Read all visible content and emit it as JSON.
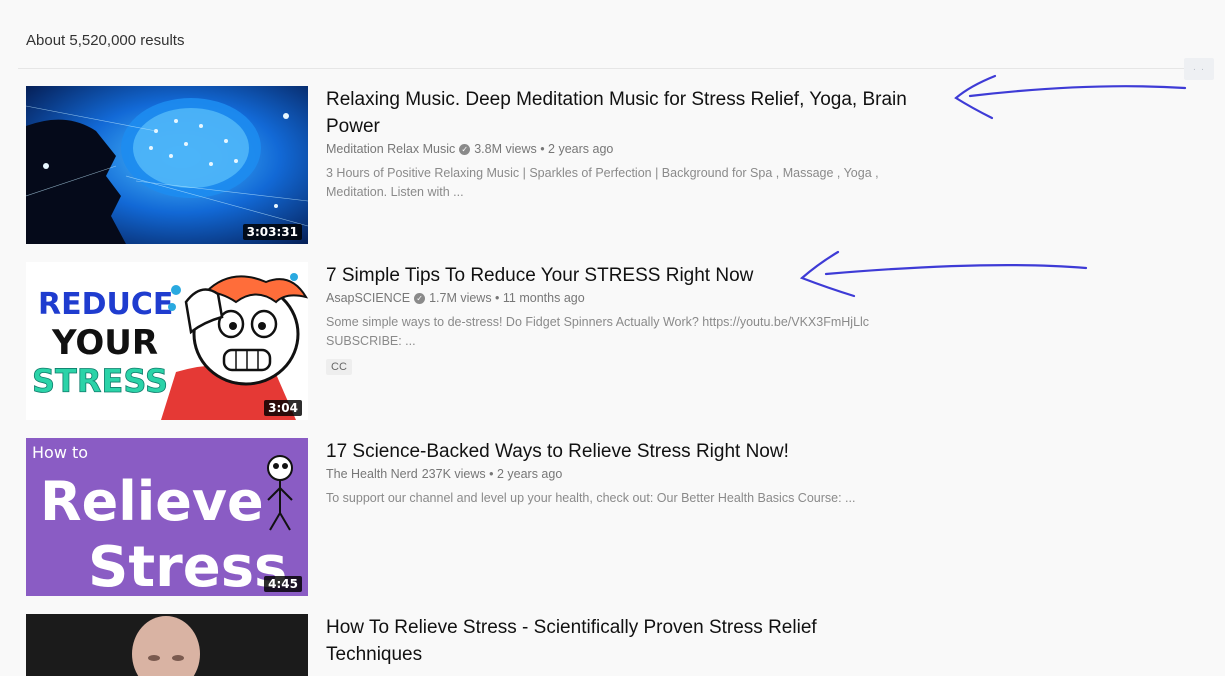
{
  "results": {
    "count_text": "About 5,520,000 results"
  },
  "corner_button": {
    "label": "· ·"
  },
  "videos": [
    {
      "title_line1": "Relaxing Music. Deep Meditation Music for Stress Relief, Yoga, Brain",
      "title_line2": "Power",
      "channel": "Meditation Relax Music",
      "verified": true,
      "stats": "3.8M views • 2 years ago",
      "description_line1": "3 Hours of Positive Relaxing Music | Sparkles of Perfection | Background for Spa , Massage , Yoga ,",
      "description_line2": "Meditation. Listen with ...",
      "duration": "3:03:31"
    },
    {
      "title_line1": "7 Simple Tips To Reduce Your STRESS Right Now",
      "channel": "AsapSCIENCE",
      "verified": true,
      "stats": "1.7M views • 11 months ago",
      "description_line1": "Some simple ways to de-stress! Do Fidget Spinners Actually Work? https://youtu.be/VKX3FmHjLlc",
      "description_line2": "SUBSCRIBE: ...",
      "badge": "CC",
      "duration": "3:04",
      "thumb_text": [
        "REDUCE",
        "YOUR",
        "STRESS"
      ]
    },
    {
      "title_line1": "17 Science-Backed Ways to Relieve Stress Right Now!",
      "channel": "The Health Nerd",
      "stats": "237K views • 2 years ago",
      "description_line1": "To support our channel and level up your health, check out: Our Better Health Basics Course: ...",
      "duration": "4:45",
      "thumb_text": [
        "How to",
        "Relieve",
        "Stress"
      ]
    },
    {
      "title_line1": "How To Relieve Stress - Scientifically Proven Stress Relief",
      "title_line2": "Techniques"
    }
  ],
  "colors": {
    "annotation_ink": "#3e3bd6",
    "background": "#f9f9f9"
  }
}
